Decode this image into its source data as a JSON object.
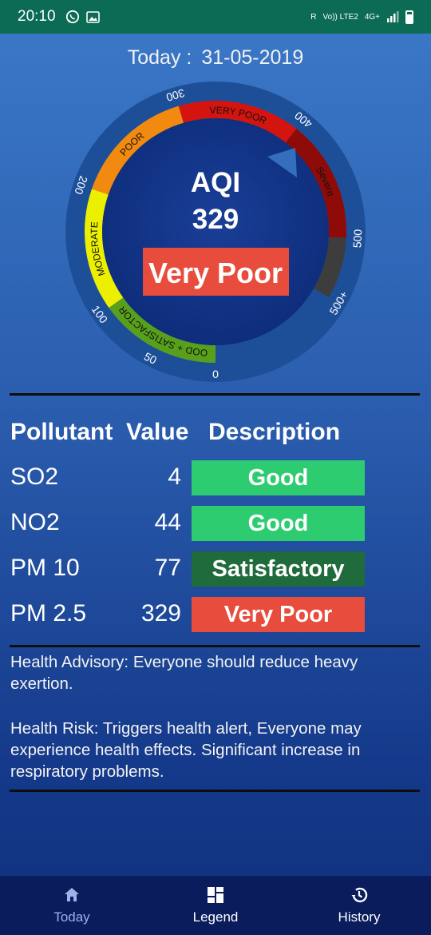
{
  "status_bar": {
    "time": "20:10",
    "left_icons": [
      "whatsapp-icon",
      "image-icon"
    ],
    "right_text": [
      "R",
      "Vo)) LTE2",
      "4G+"
    ]
  },
  "header": {
    "today_label": "Today :",
    "date": "31-05-2019"
  },
  "gauge": {
    "title": "AQI",
    "value": 329,
    "category": "Very Poor",
    "category_color": "#e74c3c",
    "bands": [
      {
        "label": "GOOD + SATISFACTORY",
        "from": 0,
        "to": 100,
        "color": "#58a01c"
      },
      {
        "label": "MODERATE",
        "from": 100,
        "to": 200,
        "color": "#ecf000"
      },
      {
        "label": "POOR",
        "from": 200,
        "to": 300,
        "color": "#f28a0f"
      },
      {
        "label": "VERY POOR",
        "from": 300,
        "to": 400,
        "color": "#d4140e"
      },
      {
        "label": "Severe",
        "from": 400,
        "to": 500,
        "color": "#8f0b08"
      },
      {
        "label": "",
        "from": 500,
        "to": 550,
        "color": "#3d3d3d"
      }
    ],
    "ticks": [
      {
        "label": "0",
        "value": 0
      },
      {
        "label": "50",
        "value": 50
      },
      {
        "label": "100",
        "value": 100
      },
      {
        "label": "200",
        "value": 200
      },
      {
        "label": "300",
        "value": 300
      },
      {
        "label": "400",
        "value": 400
      },
      {
        "label": "500",
        "value": 500
      },
      {
        "label": "500+",
        "value": 550
      }
    ]
  },
  "table": {
    "headers": {
      "pollutant": "Pollutant",
      "value": "Value",
      "description": "Description"
    },
    "rows": [
      {
        "name": "SO2",
        "value": "4",
        "desc": "Good",
        "color": "#2ecc71"
      },
      {
        "name": "NO2",
        "value": "44",
        "desc": "Good",
        "color": "#2ecc71"
      },
      {
        "name": "PM 10",
        "value": "77",
        "desc": "Satisfactory",
        "color": "#1f6b3b"
      },
      {
        "name": "PM 2.5",
        "value": "329",
        "desc": "Very Poor",
        "color": "#e74c3c"
      }
    ]
  },
  "advisory": "Health Advisory: Everyone should reduce heavy exertion.",
  "risk": "Health Risk: Triggers health alert, Everyone may experience health effects. Significant increase in respiratory problems.",
  "nav": {
    "today": "Today",
    "legend": "Legend",
    "history": "History"
  }
}
